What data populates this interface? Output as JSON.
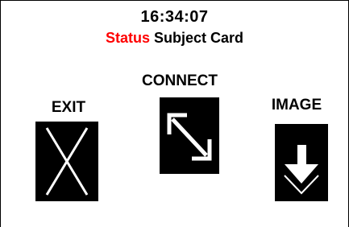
{
  "header": {
    "time": "16:34:07",
    "status_label": "Status",
    "status_text": "Subject Card"
  },
  "buttons": {
    "exit": {
      "label": "EXIT",
      "icon": "close-icon"
    },
    "connect": {
      "label": "CONNECT",
      "icon": "expand-arrow-icon"
    },
    "image": {
      "label": "IMAGE",
      "icon": "download-arrow-icon"
    }
  },
  "colors": {
    "background": "#ffffff",
    "text": "#000000",
    "status_accent": "#ff0000",
    "button_fill": "#000000",
    "icon_stroke": "#ffffff"
  }
}
